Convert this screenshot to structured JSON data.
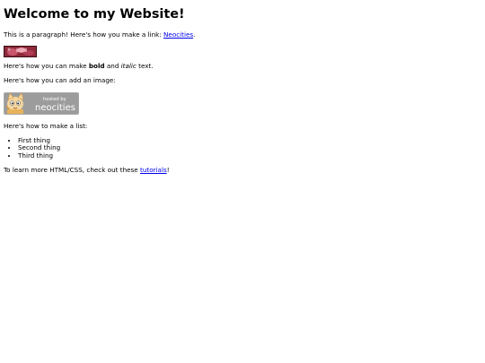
{
  "page": {
    "title": "Welcome to my Website!",
    "para_link_before": "This is a paragraph! Here's how you make a link: ",
    "para_link_text": "Neocities",
    "para_link_after": ".",
    "bold_before": "Here's how you can make ",
    "bold_text": "bold",
    "bold_middle": " and ",
    "italic_text": "italic",
    "bold_after": " text.",
    "image_intro": "Here's how you can add an image:",
    "hosted_badge_line1": "hosted by",
    "hosted_badge_line2": "neocities",
    "list_intro": "Here's how to make a list:",
    "list_items": [
      "First thing",
      "Second thing",
      "Third thing"
    ],
    "footer_before": "To learn more HTML/CSS, check out these ",
    "footer_link_text": "tutorials",
    "footer_after": "!"
  }
}
